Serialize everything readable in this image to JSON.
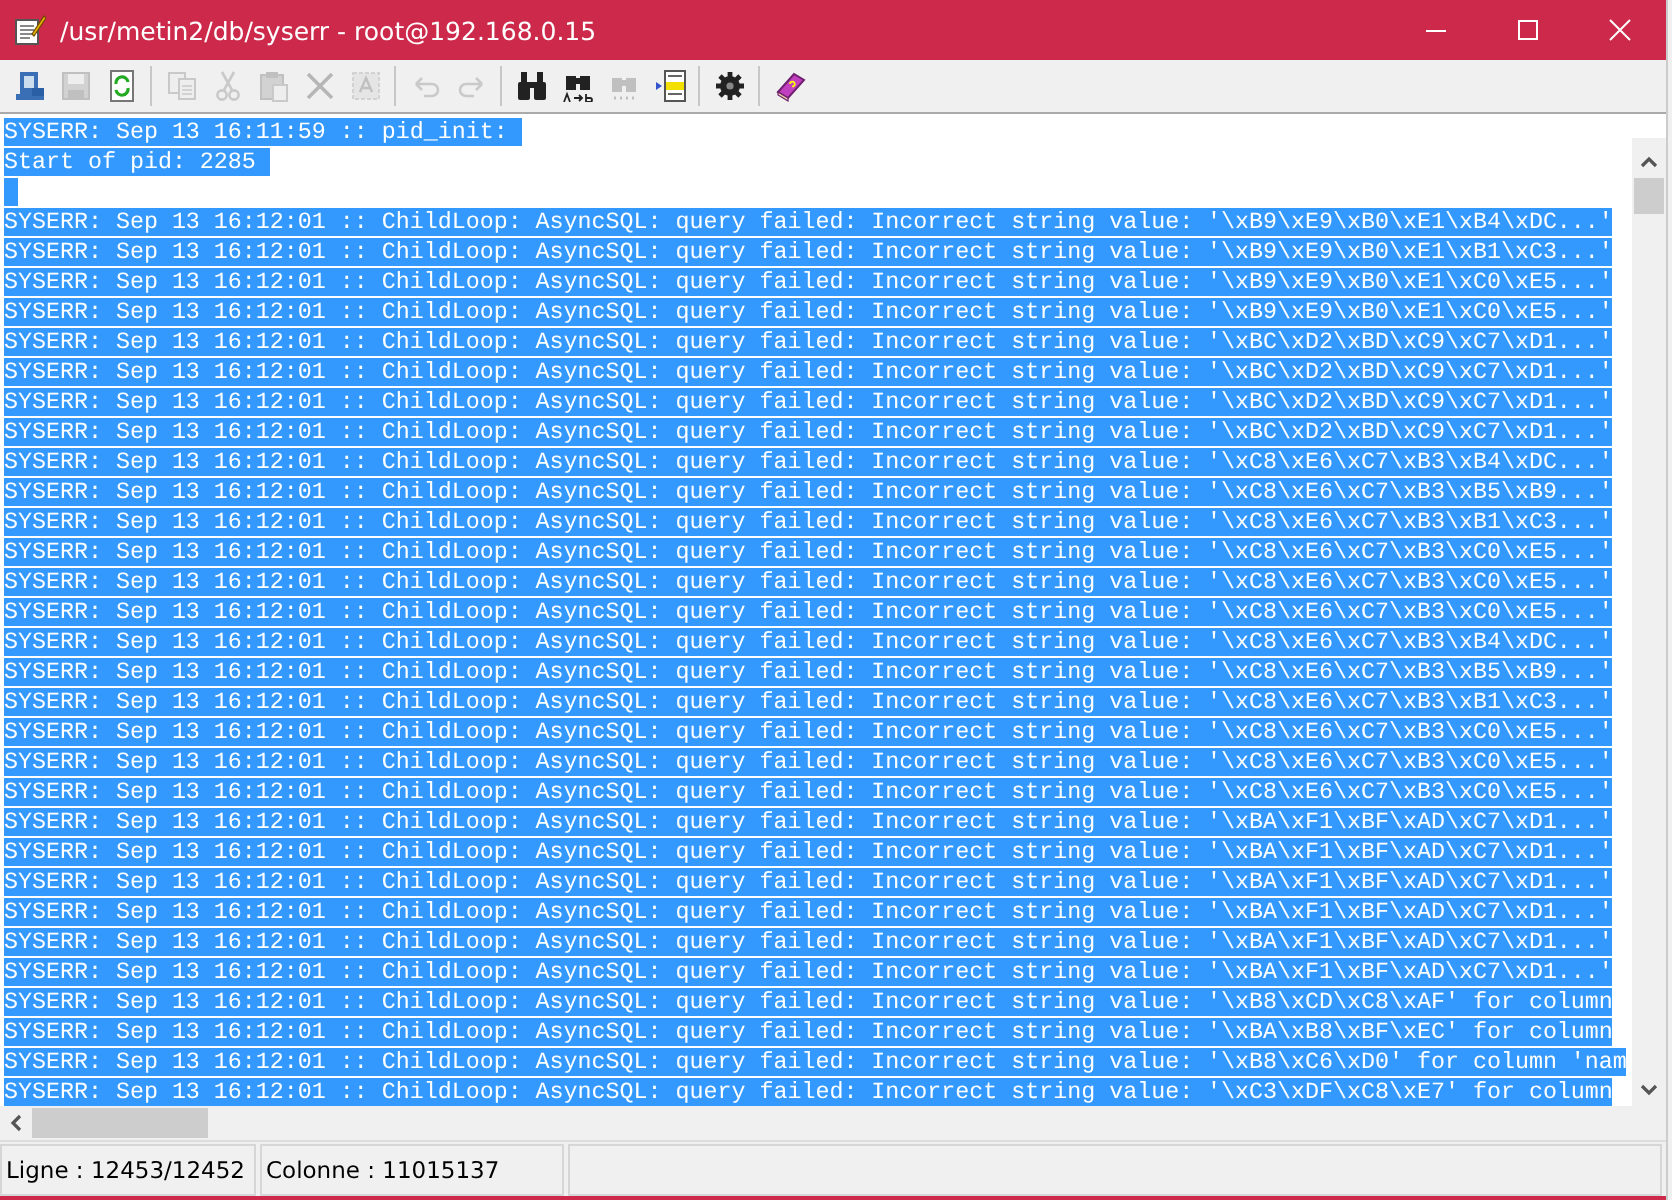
{
  "window": {
    "title": "/usr/metin2/db/syserr - root@192.168.0.15"
  },
  "toolbar": [
    {
      "kind": "computer",
      "disabled": false
    },
    {
      "kind": "save",
      "disabled": true
    },
    {
      "kind": "reload",
      "disabled": false
    },
    {
      "kind": "separator"
    },
    {
      "kind": "copy",
      "disabled": true
    },
    {
      "kind": "cut",
      "disabled": true
    },
    {
      "kind": "paste",
      "disabled": true
    },
    {
      "kind": "delete",
      "disabled": true
    },
    {
      "kind": "selectall",
      "disabled": true
    },
    {
      "kind": "separator"
    },
    {
      "kind": "undo",
      "disabled": true
    },
    {
      "kind": "redo",
      "disabled": true
    },
    {
      "kind": "separator"
    },
    {
      "kind": "find",
      "disabled": false
    },
    {
      "kind": "replace",
      "disabled": false
    },
    {
      "kind": "findnext",
      "disabled": true
    },
    {
      "kind": "gotoline",
      "disabled": false
    },
    {
      "kind": "separator"
    },
    {
      "kind": "settings",
      "disabled": false
    },
    {
      "kind": "separator"
    },
    {
      "kind": "help",
      "disabled": false
    }
  ],
  "lines": [
    {
      "text": "SYSERR: Sep 13 16:11:59 :: pid_init: ",
      "selected": true
    },
    {
      "text": "Start of pid: 2285 ",
      "selected": true
    },
    {
      "selected": true
    },
    {
      "text": "SYSERR: Sep 13 16:12:01 :: ChildLoop: AsyncSQL: query failed: Incorrect string value: '\\xB9\\xE9\\xB0\\xE1\\xB4\\xDC...'",
      "selected": true
    },
    {
      "text": "SYSERR: Sep 13 16:12:01 :: ChildLoop: AsyncSQL: query failed: Incorrect string value: '\\xB9\\xE9\\xB0\\xE1\\xB1\\xC3...'",
      "selected": true
    },
    {
      "text": "SYSERR: Sep 13 16:12:01 :: ChildLoop: AsyncSQL: query failed: Incorrect string value: '\\xB9\\xE9\\xB0\\xE1\\xC0\\xE5...'",
      "selected": true
    },
    {
      "text": "SYSERR: Sep 13 16:12:01 :: ChildLoop: AsyncSQL: query failed: Incorrect string value: '\\xB9\\xE9\\xB0\\xE1\\xC0\\xE5...'",
      "selected": true
    },
    {
      "text": "SYSERR: Sep 13 16:12:01 :: ChildLoop: AsyncSQL: query failed: Incorrect string value: '\\xBC\\xD2\\xBD\\xC9\\xC7\\xD1...'",
      "selected": true
    },
    {
      "text": "SYSERR: Sep 13 16:12:01 :: ChildLoop: AsyncSQL: query failed: Incorrect string value: '\\xBC\\xD2\\xBD\\xC9\\xC7\\xD1...'",
      "selected": true
    },
    {
      "text": "SYSERR: Sep 13 16:12:01 :: ChildLoop: AsyncSQL: query failed: Incorrect string value: '\\xBC\\xD2\\xBD\\xC9\\xC7\\xD1...'",
      "selected": true
    },
    {
      "text": "SYSERR: Sep 13 16:12:01 :: ChildLoop: AsyncSQL: query failed: Incorrect string value: '\\xBC\\xD2\\xBD\\xC9\\xC7\\xD1...'",
      "selected": true
    },
    {
      "text": "SYSERR: Sep 13 16:12:01 :: ChildLoop: AsyncSQL: query failed: Incorrect string value: '\\xC8\\xE6\\xC7\\xB3\\xB4\\xDC...'",
      "selected": true
    },
    {
      "text": "SYSERR: Sep 13 16:12:01 :: ChildLoop: AsyncSQL: query failed: Incorrect string value: '\\xC8\\xE6\\xC7\\xB3\\xB5\\xB9...'",
      "selected": true
    },
    {
      "text": "SYSERR: Sep 13 16:12:01 :: ChildLoop: AsyncSQL: query failed: Incorrect string value: '\\xC8\\xE6\\xC7\\xB3\\xB1\\xC3...'",
      "selected": true
    },
    {
      "text": "SYSERR: Sep 13 16:12:01 :: ChildLoop: AsyncSQL: query failed: Incorrect string value: '\\xC8\\xE6\\xC7\\xB3\\xC0\\xE5...'",
      "selected": true
    },
    {
      "text": "SYSERR: Sep 13 16:12:01 :: ChildLoop: AsyncSQL: query failed: Incorrect string value: '\\xC8\\xE6\\xC7\\xB3\\xC0\\xE5...'",
      "selected": true
    },
    {
      "text": "SYSERR: Sep 13 16:12:01 :: ChildLoop: AsyncSQL: query failed: Incorrect string value: '\\xC8\\xE6\\xC7\\xB3\\xC0\\xE5...'",
      "selected": true
    },
    {
      "text": "SYSERR: Sep 13 16:12:01 :: ChildLoop: AsyncSQL: query failed: Incorrect string value: '\\xC8\\xE6\\xC7\\xB3\\xB4\\xDC...'",
      "selected": true
    },
    {
      "text": "SYSERR: Sep 13 16:12:01 :: ChildLoop: AsyncSQL: query failed: Incorrect string value: '\\xC8\\xE6\\xC7\\xB3\\xB5\\xB9...'",
      "selected": true
    },
    {
      "text": "SYSERR: Sep 13 16:12:01 :: ChildLoop: AsyncSQL: query failed: Incorrect string value: '\\xC8\\xE6\\xC7\\xB3\\xB1\\xC3...'",
      "selected": true
    },
    {
      "text": "SYSERR: Sep 13 16:12:01 :: ChildLoop: AsyncSQL: query failed: Incorrect string value: '\\xC8\\xE6\\xC7\\xB3\\xC0\\xE5...'",
      "selected": true
    },
    {
      "text": "SYSERR: Sep 13 16:12:01 :: ChildLoop: AsyncSQL: query failed: Incorrect string value: '\\xC8\\xE6\\xC7\\xB3\\xC0\\xE5...'",
      "selected": true
    },
    {
      "text": "SYSERR: Sep 13 16:12:01 :: ChildLoop: AsyncSQL: query failed: Incorrect string value: '\\xC8\\xE6\\xC7\\xB3\\xC0\\xE5...'",
      "selected": true
    },
    {
      "text": "SYSERR: Sep 13 16:12:01 :: ChildLoop: AsyncSQL: query failed: Incorrect string value: '\\xBA\\xF1\\xBF\\xAD\\xC7\\xD1...'",
      "selected": true
    },
    {
      "text": "SYSERR: Sep 13 16:12:01 :: ChildLoop: AsyncSQL: query failed: Incorrect string value: '\\xBA\\xF1\\xBF\\xAD\\xC7\\xD1...'",
      "selected": true
    },
    {
      "text": "SYSERR: Sep 13 16:12:01 :: ChildLoop: AsyncSQL: query failed: Incorrect string value: '\\xBA\\xF1\\xBF\\xAD\\xC7\\xD1...'",
      "selected": true
    },
    {
      "text": "SYSERR: Sep 13 16:12:01 :: ChildLoop: AsyncSQL: query failed: Incorrect string value: '\\xBA\\xF1\\xBF\\xAD\\xC7\\xD1...'",
      "selected": true
    },
    {
      "text": "SYSERR: Sep 13 16:12:01 :: ChildLoop: AsyncSQL: query failed: Incorrect string value: '\\xBA\\xF1\\xBF\\xAD\\xC7\\xD1...'",
      "selected": true
    },
    {
      "text": "SYSERR: Sep 13 16:12:01 :: ChildLoop: AsyncSQL: query failed: Incorrect string value: '\\xBA\\xF1\\xBF\\xAD\\xC7\\xD1...'",
      "selected": true
    },
    {
      "text": "SYSERR: Sep 13 16:12:01 :: ChildLoop: AsyncSQL: query failed: Incorrect string value: '\\xB8\\xCD\\xC8\\xAF' for column",
      "selected": true
    },
    {
      "text": "SYSERR: Sep 13 16:12:01 :: ChildLoop: AsyncSQL: query failed: Incorrect string value: '\\xBA\\xB8\\xBF\\xEC' for column",
      "selected": true
    },
    {
      "text": "SYSERR: Sep 13 16:12:01 :: ChildLoop: AsyncSQL: query failed: Incorrect string value: '\\xB8\\xC6\\xD0' for column 'nam",
      "selected": true
    },
    {
      "text": "SYSERR: Sep 13 16:12:01 :: ChildLoop: AsyncSQL: query failed: Incorrect string value: '\\xC3\\xDF\\xC8\\xE7' for column",
      "selected": true
    }
  ],
  "status_bar": {
    "line": "Ligne : 12453/12452",
    "column": "Colonne : 11015137"
  }
}
